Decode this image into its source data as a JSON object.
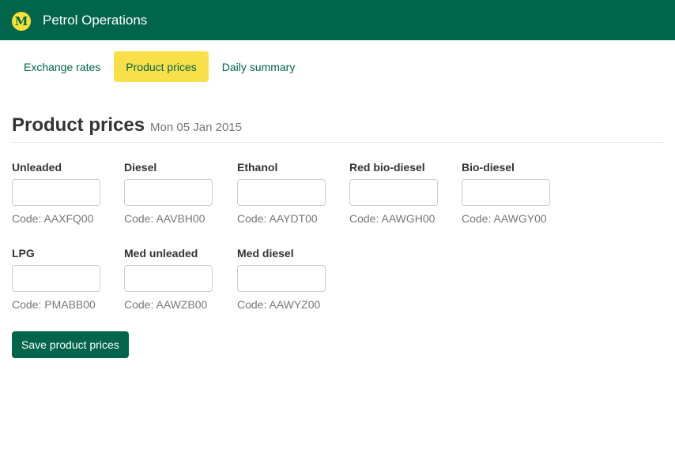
{
  "header": {
    "logo_letter": "M",
    "title": "Petrol Operations"
  },
  "tabs": [
    {
      "label": "Exchange rates",
      "active": false
    },
    {
      "label": "Product prices",
      "active": true
    },
    {
      "label": "Daily summary",
      "active": false
    }
  ],
  "page": {
    "title": "Product prices",
    "date": "Mon 05 Jan 2015"
  },
  "products": [
    {
      "name": "Unleaded",
      "value": "",
      "code": "Code: AAXFQ00"
    },
    {
      "name": "Diesel",
      "value": "",
      "code": "Code: AAVBH00"
    },
    {
      "name": "Ethanol",
      "value": "",
      "code": "Code: AAYDT00"
    },
    {
      "name": "Red bio-diesel",
      "value": "",
      "code": "Code: AAWGH00"
    },
    {
      "name": "Bio-diesel",
      "value": "",
      "code": "Code: AAWGY00"
    },
    {
      "name": "LPG",
      "value": "",
      "code": "Code: PMABB00"
    },
    {
      "name": "Med unleaded",
      "value": "",
      "code": "Code: AAWZB00"
    },
    {
      "name": "Med diesel",
      "value": "",
      "code": "Code: AAWYZ00"
    }
  ],
  "save_label": "Save product prices",
  "colors": {
    "brand_green": "#00654a",
    "brand_yellow": "#f9e04b"
  }
}
